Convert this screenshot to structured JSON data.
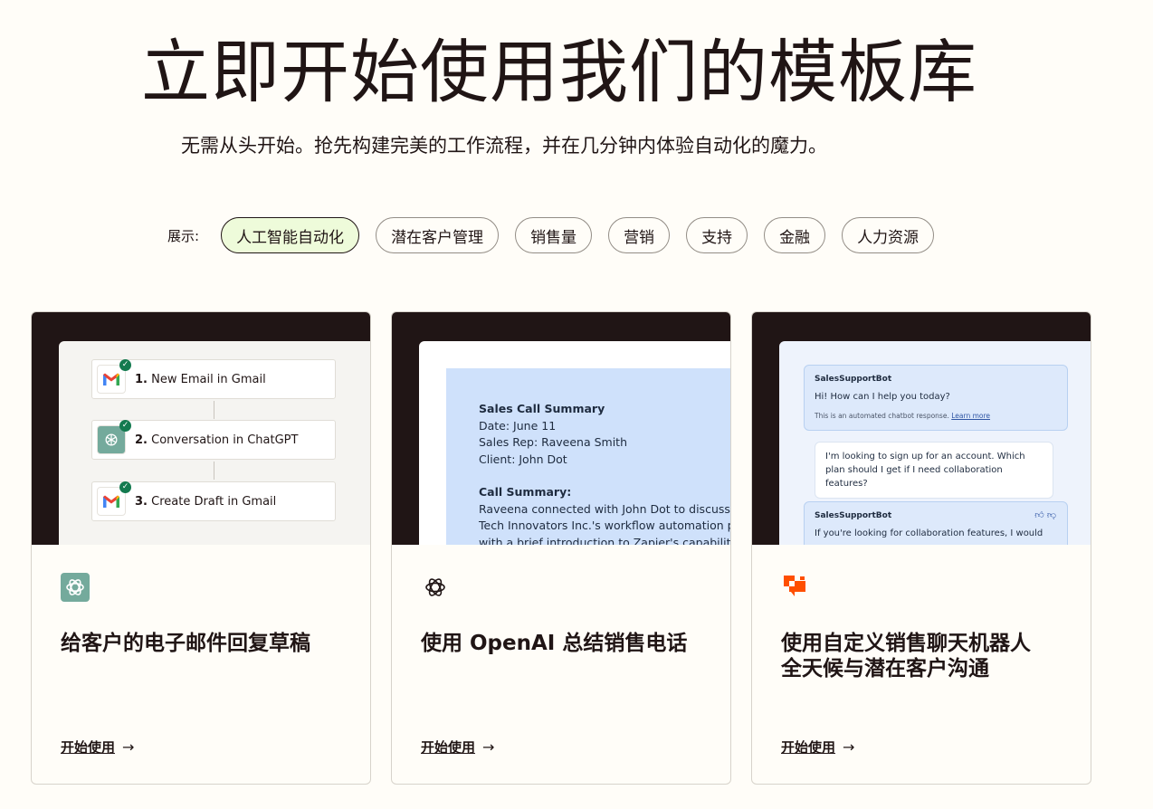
{
  "hero": {
    "title": "立即开始使用我们的模板库",
    "subtitle": "无需从头开始。抢先构建完美的工作流程，并在几分钟内体验自动化的魔力。"
  },
  "filters": {
    "label": "展示:",
    "pills": [
      "人工智能自动化",
      "潜在客户管理",
      "销售量",
      "营销",
      "支持",
      "金融",
      "人力资源"
    ],
    "active": "人工智能自动化"
  },
  "cards": [
    {
      "title": "给客户的电子邮件回复草稿",
      "cta": "开始使用",
      "steps": [
        {
          "num": "1.",
          "text": "New Email in Gmail"
        },
        {
          "num": "2.",
          "text": "Conversation in ChatGPT"
        },
        {
          "num": "3.",
          "text": "Create Draft in Gmail"
        }
      ]
    },
    {
      "title": "使用 OpenAI 总结销售电话",
      "cta": "开始使用",
      "doc": {
        "heading": "Sales Call Summary",
        "date": "Date: June 11",
        "rep": "Sales Rep: Raveena Smith",
        "client": "Client: John Dot",
        "section": "Call Summary:",
        "line1": "Raveena connected with John Dot to discuss how",
        "line2": "Tech Innovators Inc.'s workflow automation process",
        "line3": "with a brief introduction to Zapier's capabilities. I"
      }
    },
    {
      "title": "使用自定义销售聊天机器人全天候与潜在客户沟通",
      "cta": "开始使用",
      "chat": {
        "bot_name": "SalesSupportBot",
        "greeting": "Hi! How can I help you today?",
        "note": "This is an automated chatbot response.",
        "note_link": "Learn more",
        "user_msg": "I'm looking to sign up for an account. Which plan should I get if I need collaboration features?",
        "bot_name_2": "SalesSupportBot",
        "bot_reply": "If you're looking for collaboration features, I would"
      }
    }
  ],
  "colors": {
    "background": "#fffdf8",
    "text": "#201515",
    "active_pill": "#eefbda",
    "thumb_dark": "#201515",
    "zapier_orange": "#ff4f00",
    "chatgpt_green": "#74aa9c"
  },
  "icons": [
    "gmail-icon",
    "chatgpt-icon",
    "openai-icon",
    "chatbot-icon",
    "check-icon",
    "arrow-right-icon",
    "thumbs-up-icon",
    "thumbs-down-icon"
  ]
}
